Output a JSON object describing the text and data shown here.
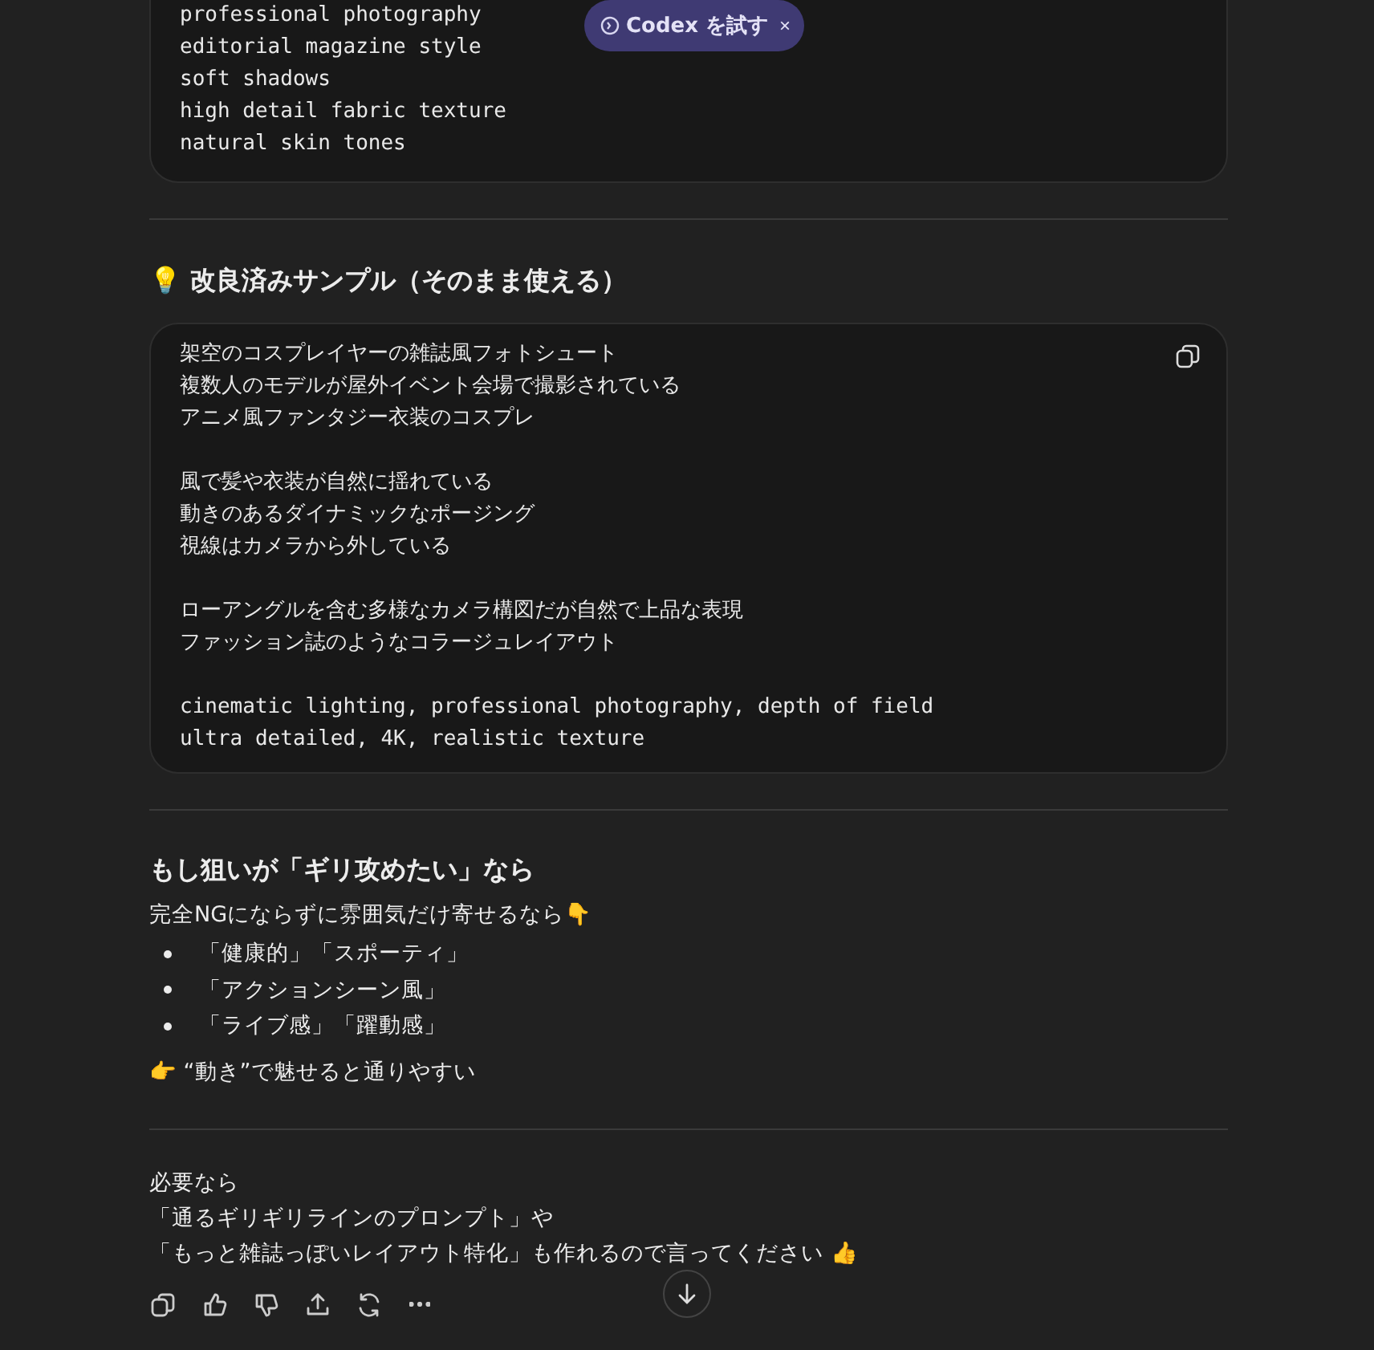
{
  "code_block_top": {
    "lines": [
      "professional photography",
      "editorial magazine style",
      "soft shadows",
      "high detail fabric texture",
      "natural skin tones"
    ]
  },
  "codex_pill": {
    "label": "Codex を試す",
    "close": "×"
  },
  "section_sample": {
    "heading": "💡 改良済みサンプル（そのまま使える）",
    "groups": [
      [
        "架空のコスプレイヤーの雑誌風フォトシュート",
        "複数人のモデルが屋外イベント会場で撮影されている",
        "アニメ風ファンタジー衣装のコスプレ"
      ],
      [
        "風で髪や衣装が自然に揺れている",
        "動きのあるダイナミックなポージング",
        "視線はカメラから外している"
      ],
      [
        "ローアングルを含む多様なカメラ構図だが自然で上品な表現",
        "ファッション誌のようなコラージュレイアウト"
      ],
      [
        "cinematic lighting, professional photography, depth of field",
        "ultra detailed, 4K, realistic texture"
      ]
    ]
  },
  "section_edge": {
    "heading": "もし狙いが「ギリ攻めたい」なら",
    "intro": "完全NGにならずに雰囲気だけ寄せるなら👇",
    "bullets": [
      "「健康的」「スポーティ」",
      "「アクションシーン風」",
      "「ライブ感」「躍動感」"
    ],
    "tip": "👉 “動き”で魅せると通りやすい"
  },
  "closing": [
    "必要なら",
    "「通るギリギリラインのプロンプト」や",
    "「もっと雑誌っぽいレイアウト特化」も作れるので言ってください 👍"
  ],
  "actions": [
    {
      "kind": "copy"
    },
    {
      "kind": "like"
    },
    {
      "kind": "dislike"
    },
    {
      "kind": "share"
    },
    {
      "kind": "regenerate"
    },
    {
      "kind": "more"
    }
  ]
}
